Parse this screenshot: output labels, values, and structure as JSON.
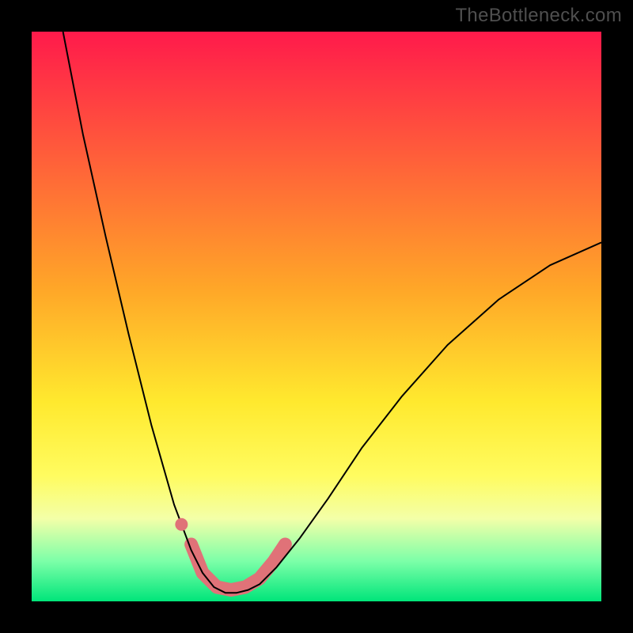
{
  "watermark": "TheBottleneck.com",
  "chart_data": {
    "type": "line",
    "title": "",
    "xlabel": "",
    "ylabel": "",
    "xlim": [
      0,
      100
    ],
    "ylim": [
      0,
      100
    ],
    "grid": false,
    "legend": false,
    "background_gradient": {
      "stops": [
        {
          "offset": 0.0,
          "color": "#ff1a4b"
        },
        {
          "offset": 0.45,
          "color": "#ffa628"
        },
        {
          "offset": 0.65,
          "color": "#ffe92e"
        },
        {
          "offset": 0.78,
          "color": "#fffc60"
        },
        {
          "offset": 0.855,
          "color": "#f3ffa8"
        },
        {
          "offset": 0.93,
          "color": "#7bffa8"
        },
        {
          "offset": 1.0,
          "color": "#00e57a"
        }
      ]
    },
    "series": [
      {
        "name": "bottleneck-curve",
        "stroke": "#000000",
        "stroke_width": 2,
        "points": [
          {
            "x": 5.5,
            "y": 100.0
          },
          {
            "x": 9.0,
            "y": 82.0
          },
          {
            "x": 13.0,
            "y": 64.0
          },
          {
            "x": 17.0,
            "y": 47.0
          },
          {
            "x": 21.0,
            "y": 31.0
          },
          {
            "x": 25.0,
            "y": 17.0
          },
          {
            "x": 28.0,
            "y": 9.0
          },
          {
            "x": 30.0,
            "y": 5.0
          },
          {
            "x": 32.0,
            "y": 2.5
          },
          {
            "x": 34.0,
            "y": 1.5
          },
          {
            "x": 36.0,
            "y": 1.5
          },
          {
            "x": 38.0,
            "y": 2.0
          },
          {
            "x": 40.0,
            "y": 3.0
          },
          {
            "x": 43.0,
            "y": 6.0
          },
          {
            "x": 47.0,
            "y": 11.0
          },
          {
            "x": 52.0,
            "y": 18.0
          },
          {
            "x": 58.0,
            "y": 27.0
          },
          {
            "x": 65.0,
            "y": 36.0
          },
          {
            "x": 73.0,
            "y": 45.0
          },
          {
            "x": 82.0,
            "y": 53.0
          },
          {
            "x": 91.0,
            "y": 59.0
          },
          {
            "x": 100.0,
            "y": 63.0
          }
        ]
      },
      {
        "name": "highlight-segment",
        "stroke": "#e07278",
        "stroke_width": 17,
        "linecap": "round",
        "points": [
          {
            "x": 28.0,
            "y": 10.0
          },
          {
            "x": 30.0,
            "y": 5.0
          },
          {
            "x": 32.5,
            "y": 2.5
          },
          {
            "x": 35.0,
            "y": 2.0
          },
          {
            "x": 37.5,
            "y": 2.5
          },
          {
            "x": 40.0,
            "y": 4.0
          },
          {
            "x": 42.5,
            "y": 7.0
          },
          {
            "x": 44.5,
            "y": 10.0
          }
        ]
      }
    ],
    "markers": [
      {
        "name": "highlight-dot",
        "x": 26.3,
        "y": 13.5,
        "r": 8,
        "fill": "#e07278"
      }
    ]
  }
}
